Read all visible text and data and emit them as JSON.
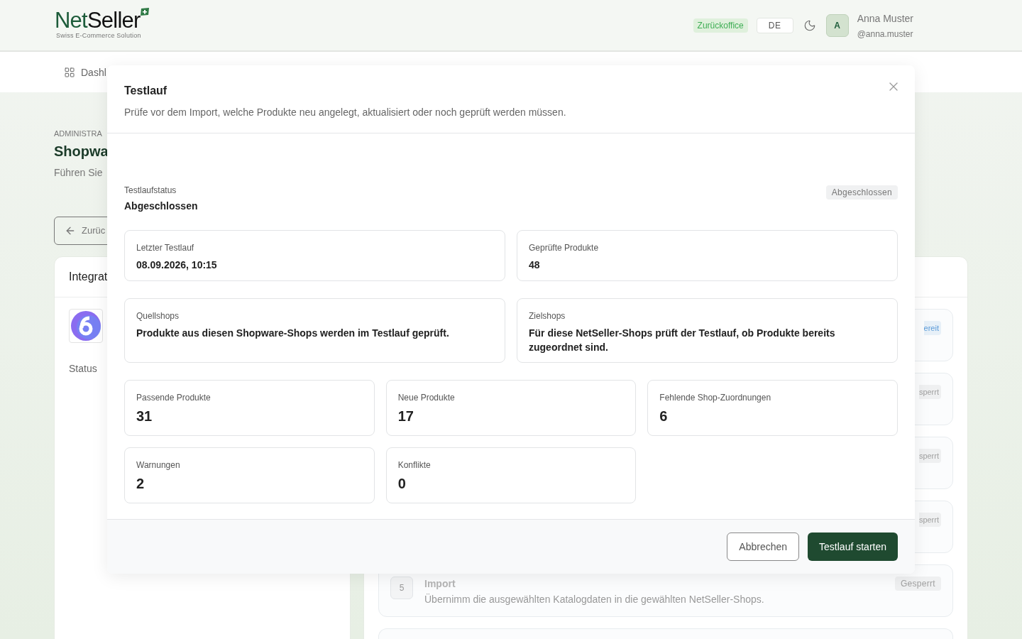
{
  "header": {
    "logo": {
      "primary": "Net",
      "secondary": "Seller",
      "tagline": "Swiss E-Commerce Solution"
    },
    "badge": "Zurückoffice",
    "language": "DE",
    "user": {
      "initial": "A",
      "name": "Anna Muster",
      "handle": "@anna.muster"
    }
  },
  "nav": {
    "items": [
      {
        "label": "Dashl"
      }
    ]
  },
  "page": {
    "eyebrow": "ADMINISTRA",
    "title": "Shopwa",
    "subtitle": "Führen Sie",
    "back_button": "Zurüc"
  },
  "left_card": {
    "title": "Integrat",
    "status_label": "Status"
  },
  "steps": [
    {
      "kind": "partial",
      "badge": "ereit",
      "color": "#5b9bd8"
    },
    {
      "kind": "partial",
      "badge": "sperrt",
      "color": "#a0a0a0"
    },
    {
      "kind": "partial",
      "badge": "sperrt",
      "color": "#a0a0a0"
    },
    {
      "kind": "partial",
      "badge": "sperrt",
      "color": "#a0a0a0"
    },
    {
      "kind": "full",
      "number": "5",
      "title": "Import",
      "description": "Übernimm die ausgewählten Katalogdaten in die gewählten NetSeller-Shops.",
      "badge": "Gesperrt",
      "color": "#a0a0a0"
    },
    {
      "kind": "empty"
    }
  ],
  "modal": {
    "title": "Testlauf",
    "description": "Prüfe vor dem Import, welche Produkte neu angelegt, aktualisiert oder noch geprüft werden müssen.",
    "status": {
      "label": "Testlaufstatus",
      "value": "Abgeschlossen",
      "badge": "Abgeschlossen"
    },
    "info_cards": [
      {
        "label": "Letzter Testlauf",
        "value": "08.09.2026, 10:15"
      },
      {
        "label": "Geprüfte Produkte",
        "value": "48"
      },
      {
        "label": "Quellshops",
        "value": "Produkte aus diesen Shopware-Shops werden im Testlauf geprüft."
      },
      {
        "label": "Zielshops",
        "value": "Für diese NetSeller-Shops prüft der Testlauf, ob Produkte bereits zugeordnet sind."
      }
    ],
    "metrics": [
      {
        "label": "Passende Produkte",
        "value": "31"
      },
      {
        "label": "Neue Produkte",
        "value": "17"
      },
      {
        "label": "Fehlende Shop-Zuordnungen",
        "value": "6"
      },
      {
        "label": "Warnungen",
        "value": "2"
      },
      {
        "label": "Konflikte",
        "value": "0"
      }
    ],
    "buttons": [
      {
        "label": "Abbrechen",
        "kind": "secondary"
      },
      {
        "label": "Testlauf starten",
        "kind": "primary"
      }
    ]
  }
}
